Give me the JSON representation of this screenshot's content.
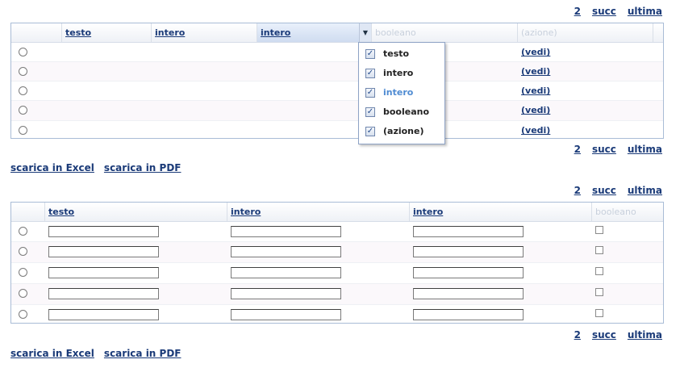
{
  "pager_top1": {
    "page": "2",
    "next": "succ",
    "last": "ultima"
  },
  "grid1": {
    "columns": [
      "testo",
      "intero",
      "intero",
      "booleano",
      "(azione)"
    ],
    "row_action": "(vedi)",
    "rows": 5
  },
  "column_menu": {
    "items": [
      {
        "label": "testo",
        "checked": true
      },
      {
        "label": "intero",
        "checked": true
      },
      {
        "label": "intero",
        "checked": true,
        "highlighted": true
      },
      {
        "label": "booleano",
        "checked": true
      },
      {
        "label": "(azione)",
        "checked": true
      }
    ]
  },
  "pager_bottom1": {
    "page": "2",
    "next": "succ",
    "last": "ultima"
  },
  "export1": {
    "excel": "scarica in Excel",
    "pdf": "scarica in PDF"
  },
  "pager_top2": {
    "page": "2",
    "next": "succ",
    "last": "ultima"
  },
  "grid2": {
    "columns": [
      "testo",
      "intero",
      "intero",
      "booleano"
    ],
    "rows": 5
  },
  "pager_bottom2": {
    "page": "2",
    "next": "succ",
    "last": "ultima"
  },
  "export2": {
    "excel": "scarica in Excel",
    "pdf": "scarica in PDF"
  }
}
